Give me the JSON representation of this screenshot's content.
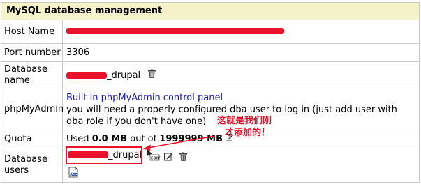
{
  "header": {
    "title": "MySQL database management"
  },
  "rows": {
    "host": {
      "label": "Host Name"
    },
    "port": {
      "label": "Port number",
      "value": "3306"
    },
    "dbname": {
      "label_line1": "Database",
      "label_line2": "name",
      "value_suffix": "_drupal"
    },
    "phpmyadmin": {
      "label": "phpMyAdmin",
      "link": "Built in phpMyAdmin control panel",
      "note_line1": "you will need a properly configured dba user to log in (just add user with",
      "note_line2": "dba role if you don't have one)"
    },
    "quota": {
      "label": "Quota",
      "used_prefix": "Used",
      "used_value": "0.0 MB",
      "out_of": "out of",
      "limit": "1999999 MB"
    },
    "dbusers": {
      "label_line1": "Database",
      "label_line2": "users",
      "value_suffix": "_drupal"
    }
  },
  "annotation": {
    "line1": "这就是我们刚",
    "line2": "才添加的！"
  },
  "colors": {
    "header_bg": "#f5f1c8",
    "border": "#c8c8c8",
    "link": "#1a1ab8",
    "annotation": "#e8132a"
  },
  "icons": [
    "trash-icon",
    "edit-icon",
    "edit-pencil-icon",
    "add-icon"
  ]
}
